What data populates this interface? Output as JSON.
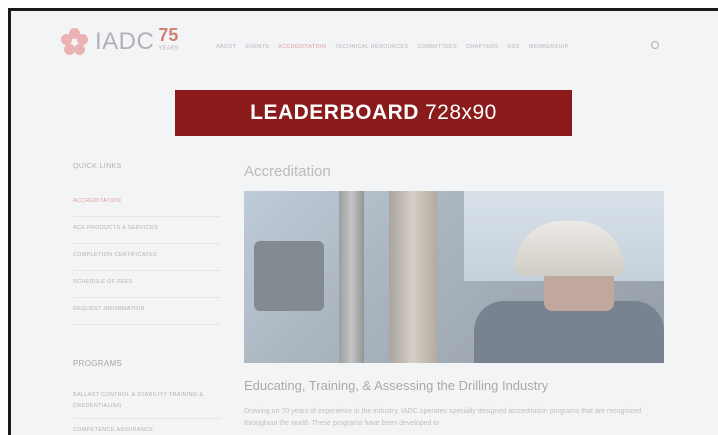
{
  "brand": {
    "name": "IADC",
    "anniversary": "75",
    "anniversary_sub": "YEARS",
    "accent": "#c0392b"
  },
  "nav": {
    "items": [
      "ABOUT",
      "EVENTS",
      "ACCREDITATION",
      "TECHNICAL RESOURCES",
      "COMMITTEES",
      "CHAPTERS",
      "RSS",
      "MEMBERSHIP"
    ],
    "active_index": 2,
    "search_icon": "search-icon"
  },
  "leaderboard": {
    "bold": "LEADERBOARD",
    "size": "728x90",
    "color": "#8b1a1a"
  },
  "sidebar": {
    "quicklinks_title": "QUICK LINKS",
    "quicklinks": [
      "ACCREDITATION",
      "ACE PRODUCTS & SERVICES",
      "COMPLETION CERTIFICATES",
      "SCHEDULE OF FEES",
      "REQUEST INFORMATION"
    ],
    "active_index": 0,
    "programs_title": "PROGRAMS",
    "programs": [
      "BALLAST CONTROL & STABILITY TRAINING & CREDENTIALING",
      "COMPETENCE ASSURANCE"
    ]
  },
  "main": {
    "title": "Accreditation",
    "subtitle": "Educating, Training, & Assessing the Drilling Industry",
    "body": "Drawing on 70 years of experience in the industry, IADC operates specially designed accreditation programs that are recognized throughout the world. These programs have been developed to"
  }
}
